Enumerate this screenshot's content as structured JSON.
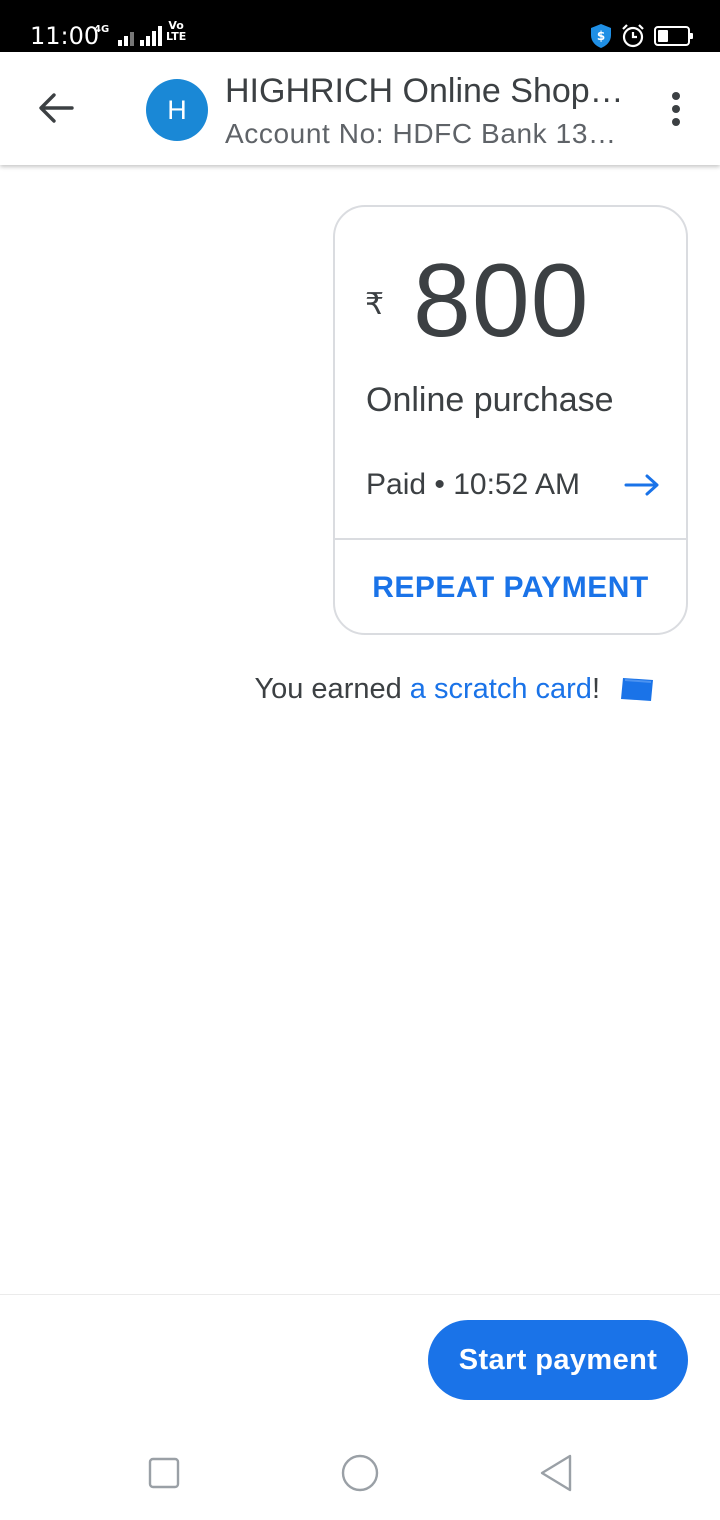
{
  "status_bar": {
    "time": "11:00",
    "network_type": "4G",
    "volte_line1": "Vo",
    "volte_line2": "LTE"
  },
  "header": {
    "avatar_letter": "H",
    "title": "HIGHRICH Online Shop…",
    "subtitle": "Account No: HDFC Bank 13…"
  },
  "payment": {
    "currency_symbol": "₹",
    "amount": "800",
    "note": "Online purchase",
    "status": "Paid • 10:52 AM",
    "repeat_label": "REPEAT PAYMENT"
  },
  "reward": {
    "prefix": "You earned ",
    "link_text": "a scratch card",
    "suffix": "!"
  },
  "actions": {
    "start_payment_label": "Start payment"
  },
  "colors": {
    "accent": "#1a73e8",
    "avatar": "#1a88d6",
    "text_primary": "#3c4043",
    "text_secondary": "#5f6368",
    "card_border": "#dadce0"
  },
  "icons": {
    "back": "arrow-left-icon",
    "more": "more-vert-icon",
    "details": "arrow-right-icon",
    "scratch_card": "scratch-card-icon",
    "nav_recents": "square-icon",
    "nav_home": "circle-icon",
    "nav_back": "triangle-back-icon"
  }
}
